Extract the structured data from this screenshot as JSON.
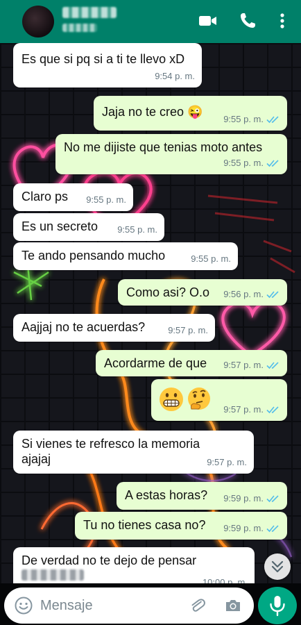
{
  "colors": {
    "header": "#008069",
    "incoming_bubble": "#ffffff",
    "outgoing_bubble": "#e7fed2",
    "read_ticks": "#53bdeb",
    "timestamp": "#667781",
    "send_button": "#00a884"
  },
  "header": {
    "icons": [
      "back-avatar",
      "video-call-icon",
      "phone-icon",
      "more-options-icon"
    ]
  },
  "messages": [
    {
      "id": "m1",
      "direction": "in",
      "text": "Es que si pq si a ti te llevo xD",
      "time": "9:54 p. m."
    },
    {
      "id": "m2",
      "direction": "out",
      "text": "Jaja no te creo 😜",
      "time": "9:55 p. m.",
      "status": "read"
    },
    {
      "id": "m3",
      "direction": "out",
      "text": "No me dijiste que tenias moto antes",
      "time": "9:55 p. m.",
      "status": "read"
    },
    {
      "id": "m4",
      "direction": "in",
      "text": "Claro ps",
      "time": "9:55 p. m."
    },
    {
      "id": "m5",
      "direction": "in",
      "text": "Es un secreto",
      "time": "9:55 p. m."
    },
    {
      "id": "m6",
      "direction": "in",
      "text": "Te ando pensando mucho",
      "time": "9:55 p. m."
    },
    {
      "id": "m7",
      "direction": "out",
      "text": "Como asi? O.o",
      "time": "9:56 p. m.",
      "status": "read"
    },
    {
      "id": "m8",
      "direction": "in",
      "text": "Aajjaj no te acuerdas?",
      "time": "9:57 p. m."
    },
    {
      "id": "m9",
      "direction": "out",
      "text": "Acordarme de que",
      "time": "9:57 p. m.",
      "status": "read"
    },
    {
      "id": "m10",
      "direction": "out",
      "emojis": [
        "grimacing-face",
        "thinking-face"
      ],
      "time": "9:57 p. m.",
      "status": "read"
    },
    {
      "id": "m11",
      "direction": "in",
      "text": "Si vienes te refresco la memoria ajajaj",
      "time": "9:57 p. m."
    },
    {
      "id": "m12",
      "direction": "out",
      "text": "A estas horas?",
      "time": "9:59 p. m.",
      "status": "read"
    },
    {
      "id": "m13",
      "direction": "out",
      "text": "Tu no tienes casa no?",
      "time": "9:59 p. m.",
      "status": "read"
    },
    {
      "id": "m14",
      "direction": "in",
      "text": "De verdad no te dejo de pensar",
      "time": "10:00 p. m."
    }
  ],
  "input": {
    "placeholder": "Mensaje",
    "value": ""
  }
}
